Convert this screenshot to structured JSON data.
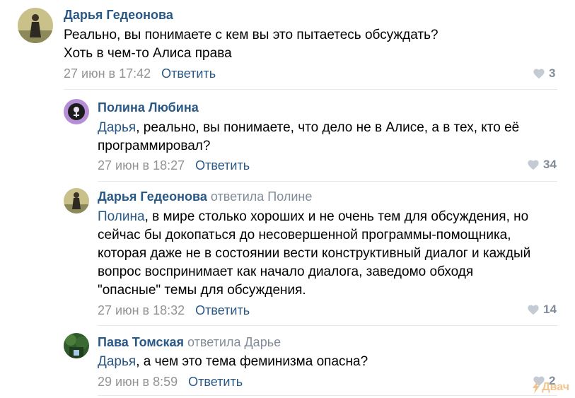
{
  "comments": [
    {
      "author": "Дарья Гедеонова",
      "reply_to": "",
      "text_lines": [
        "Реально, вы понимаете с кем вы это пытаетесь обсуждать?",
        "Хоть в чем-то Алиса права"
      ],
      "date": "27 июн в 17:42",
      "reply_label": "Ответить",
      "likes": "3"
    },
    {
      "author": "Полина Любина",
      "reply_to": "",
      "mention": "Дарья",
      "text_lines": [
        ", реально, вы понимаете, что дело не в Алисе, а в тех, кто её",
        "программировал?"
      ],
      "date": "27 июн в 18:27",
      "reply_label": "Ответить",
      "likes": "34"
    },
    {
      "author": "Дарья Гедеонова",
      "reply_to": "ответила Полине",
      "mention": "Полина",
      "text_lines": [
        ", в мире столько хороших и не очень тем для обсуждения, но",
        "сейчас бы докопаться до несовершенной программы-помощника,",
        "которая даже не в состоянии вести конструктивный диалог и каждый",
        "вопрос воспринимает как начало диалога, заведомо обходя",
        "\"опасные\" темы для обсуждения."
      ],
      "date": "27 июн в 18:32",
      "reply_label": "Ответить",
      "likes": "14"
    },
    {
      "author": "Пава Томская",
      "reply_to": "ответила Дарье",
      "mention": "Дарья",
      "text_lines": [
        ", а чем это тема феминизма опасна?"
      ],
      "date": "29 июн в 8:59",
      "reply_label": "Ответить",
      "likes": "2"
    }
  ],
  "watermark": "Двач",
  "colors": {
    "link": "#2a5885",
    "meta": "#939393",
    "divider": "#e7e8ec"
  }
}
